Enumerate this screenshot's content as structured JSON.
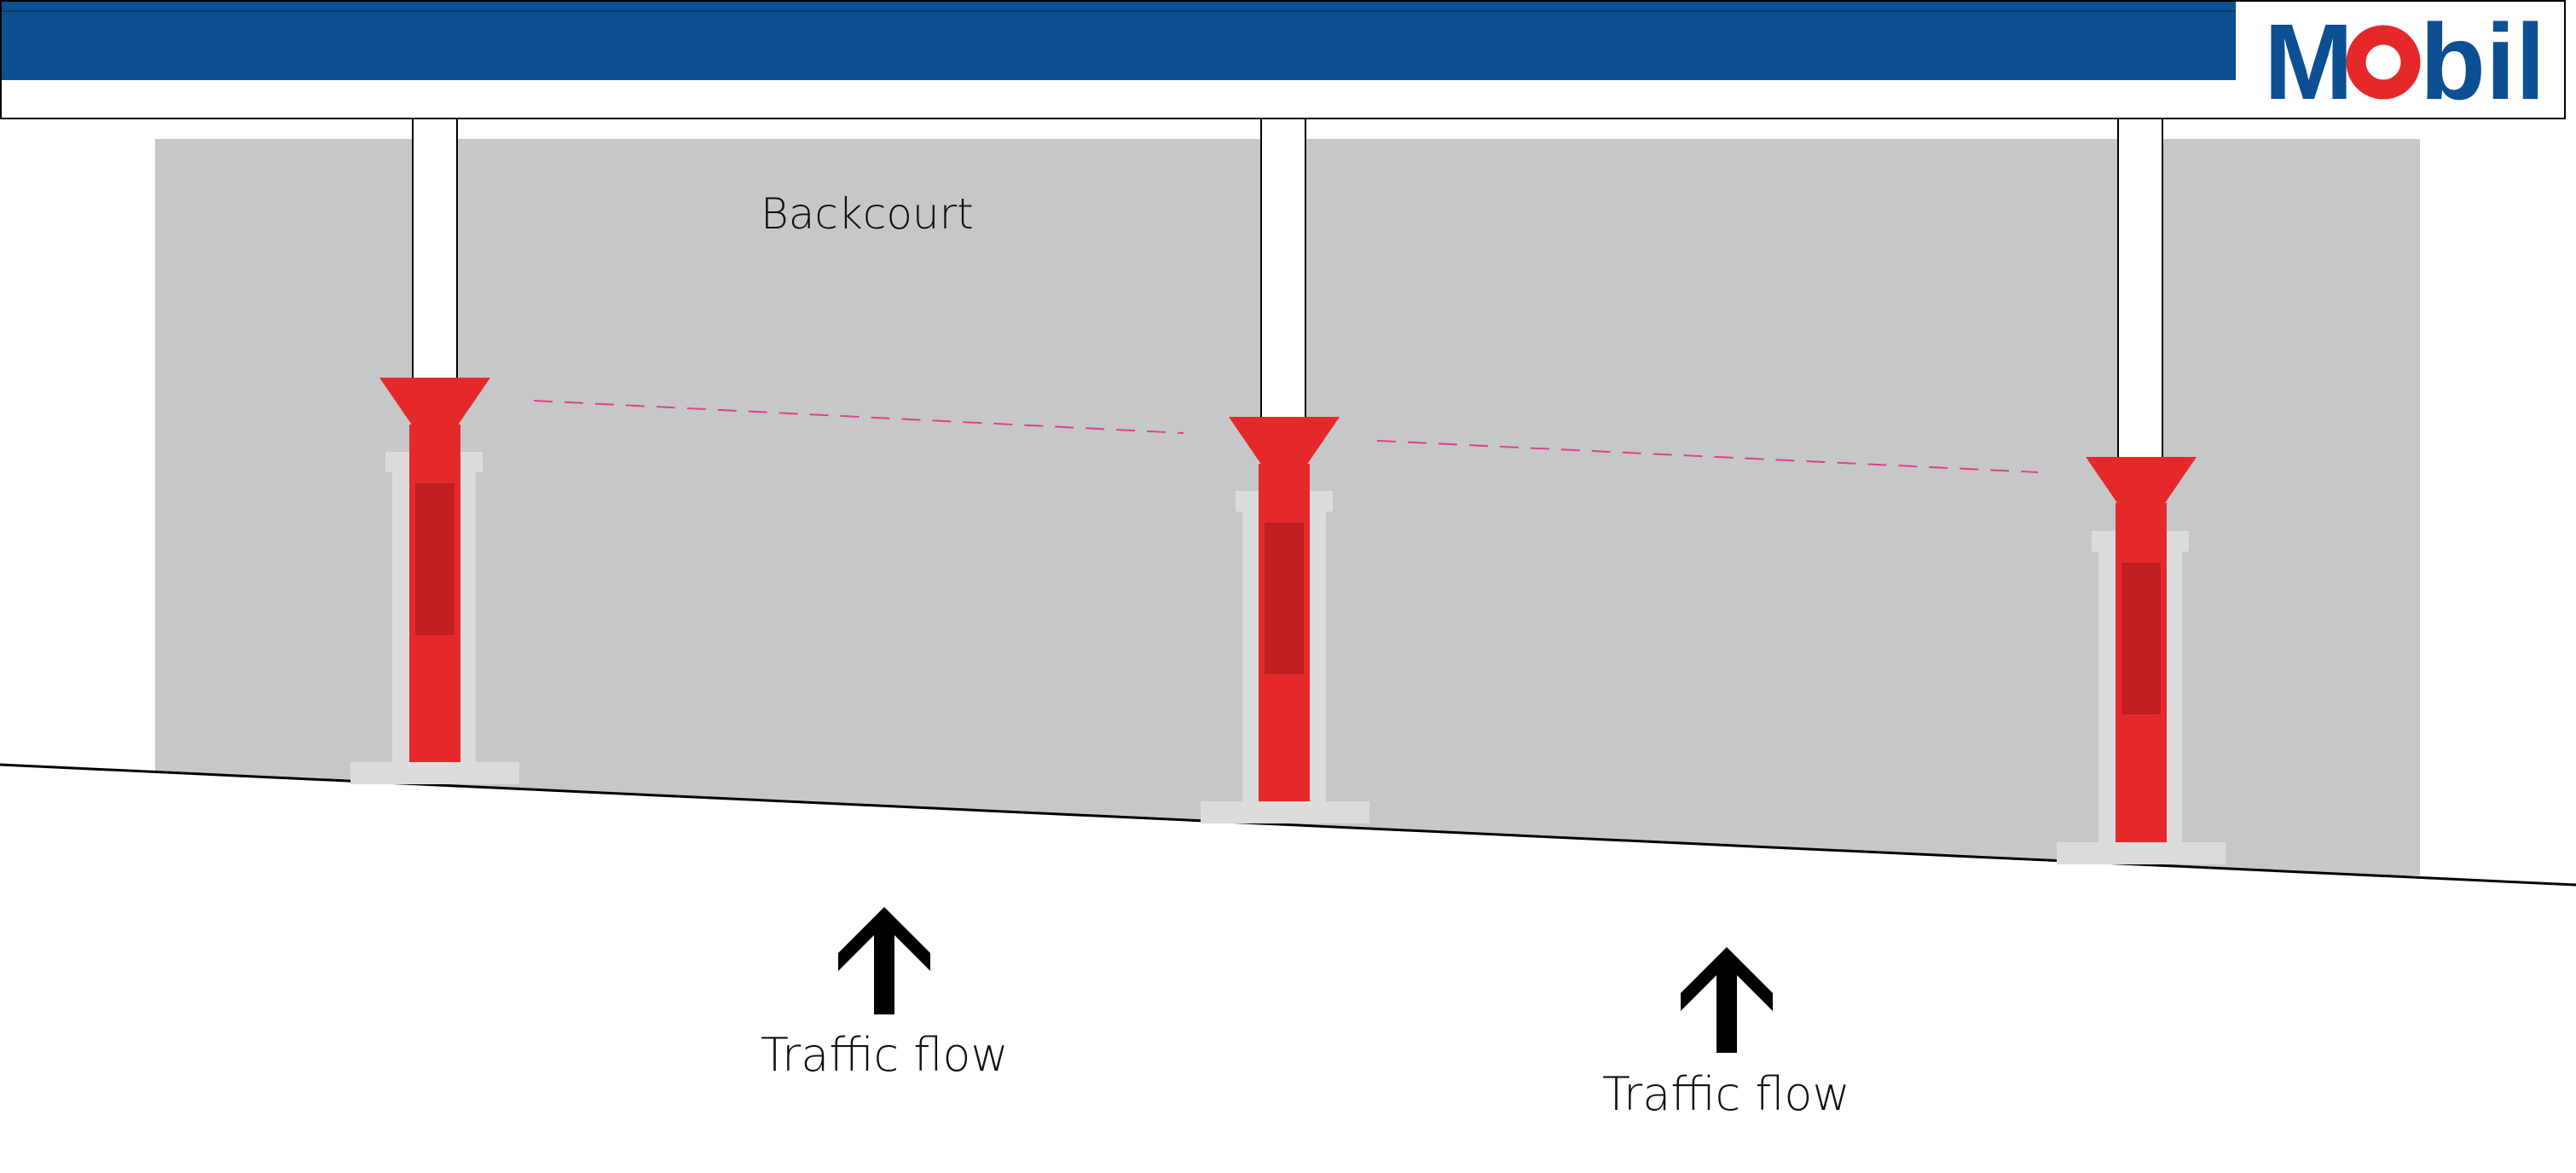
{
  "brand": {
    "logo_text": "Mobil",
    "logo_prefix": "M",
    "logo_o": "o",
    "logo_suffix": "bil",
    "blue": "#0d4f93",
    "red": "#e5292b"
  },
  "labels": {
    "backcourt": "Backcourt",
    "traffic_flow_left": "Traffic flow",
    "traffic_flow_right": "Traffic flow"
  },
  "icons": {
    "arrow": "arrow-up-icon"
  },
  "colors": {
    "canopy_blue": "#0d4f93",
    "backcourt_gray": "#c6c7c9",
    "island_light": "#dcdcdd",
    "pump_red": "#e5292b",
    "pump_dark": "#c01e21",
    "guide_magenta": "#e0418a",
    "outline": "#000000"
  }
}
